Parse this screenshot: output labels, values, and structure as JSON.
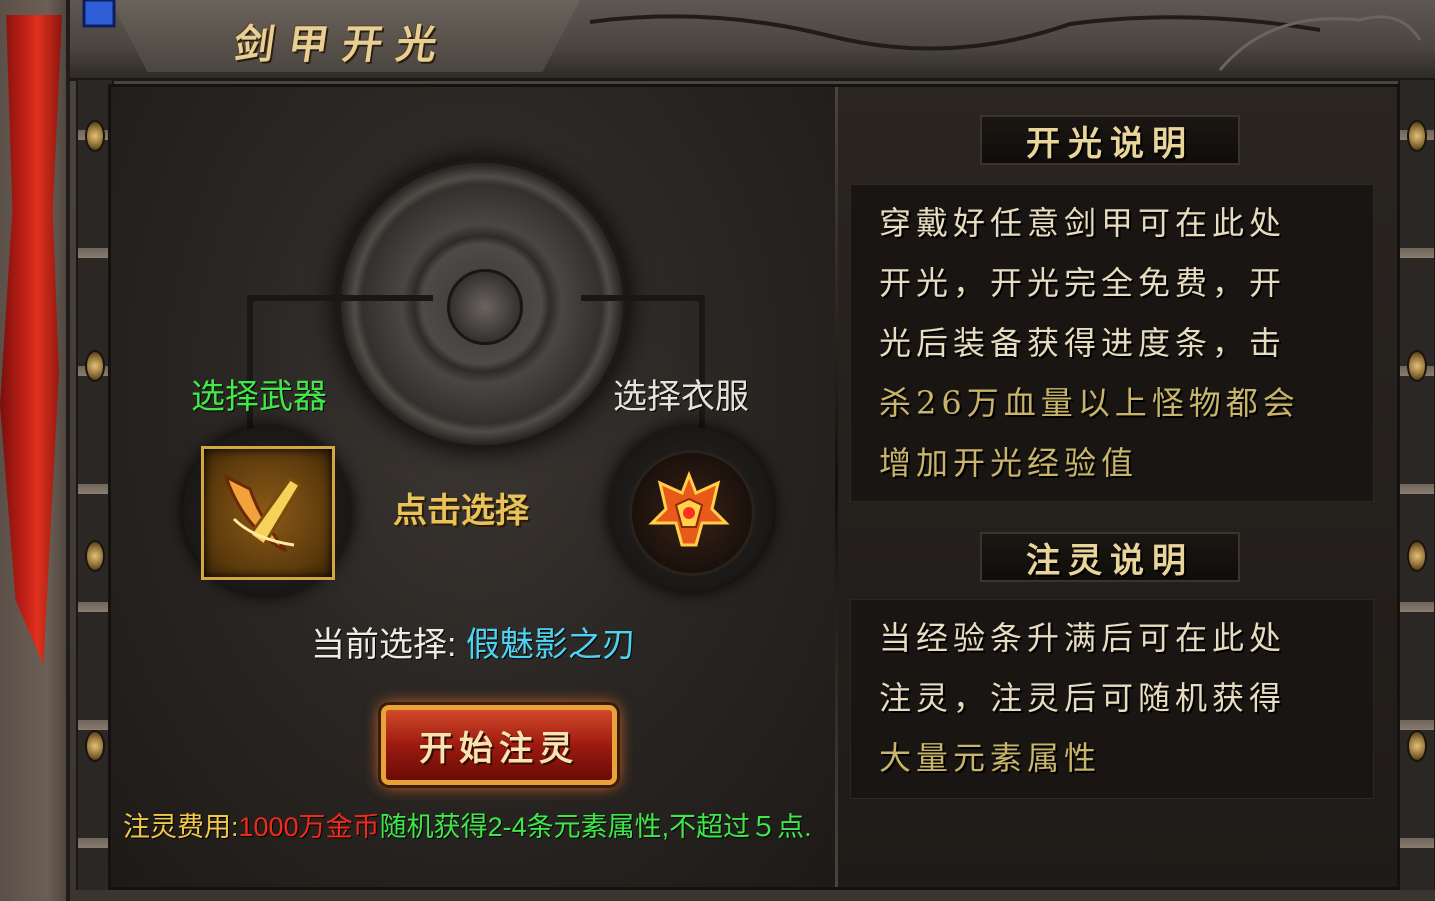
{
  "window": {
    "title": "剑甲开光"
  },
  "left_panel": {
    "weapon_label": "选择武器",
    "clothes_label": "选择衣服",
    "click_select": "点击选择",
    "current_label": "当前选择:",
    "current_value": "假魅影之刃",
    "start_button": "开始注灵",
    "cost": {
      "label": "注灵费用:",
      "value": "1000万金币",
      "desc": "随机获得2-4条元素属性,不超过５点."
    }
  },
  "right_panel": {
    "kaiguang": {
      "heading": "开光说明",
      "lines": [
        "穿戴好任意剑甲可在此处",
        "开光，开光完全免费，开",
        "光后装备获得进度条，击",
        "杀26万血量以上怪物都会",
        "增加开光经验值"
      ]
    },
    "zhuling": {
      "heading": "注灵说明",
      "lines": [
        "当经验条升满后可在此处",
        "注灵，注灵后可随机获得",
        "大量元素属性"
      ]
    }
  },
  "colors": {
    "weapon_label": "#42e84a",
    "current_value": "#4fd2f0",
    "cost_value": "#f02a1a",
    "cost_desc": "#3ee84a",
    "accent_text": "#c8b46a"
  },
  "icons": {
    "weapon_slot": "golden-blade-icon",
    "clothes_slot": "flame-armor-icon"
  }
}
